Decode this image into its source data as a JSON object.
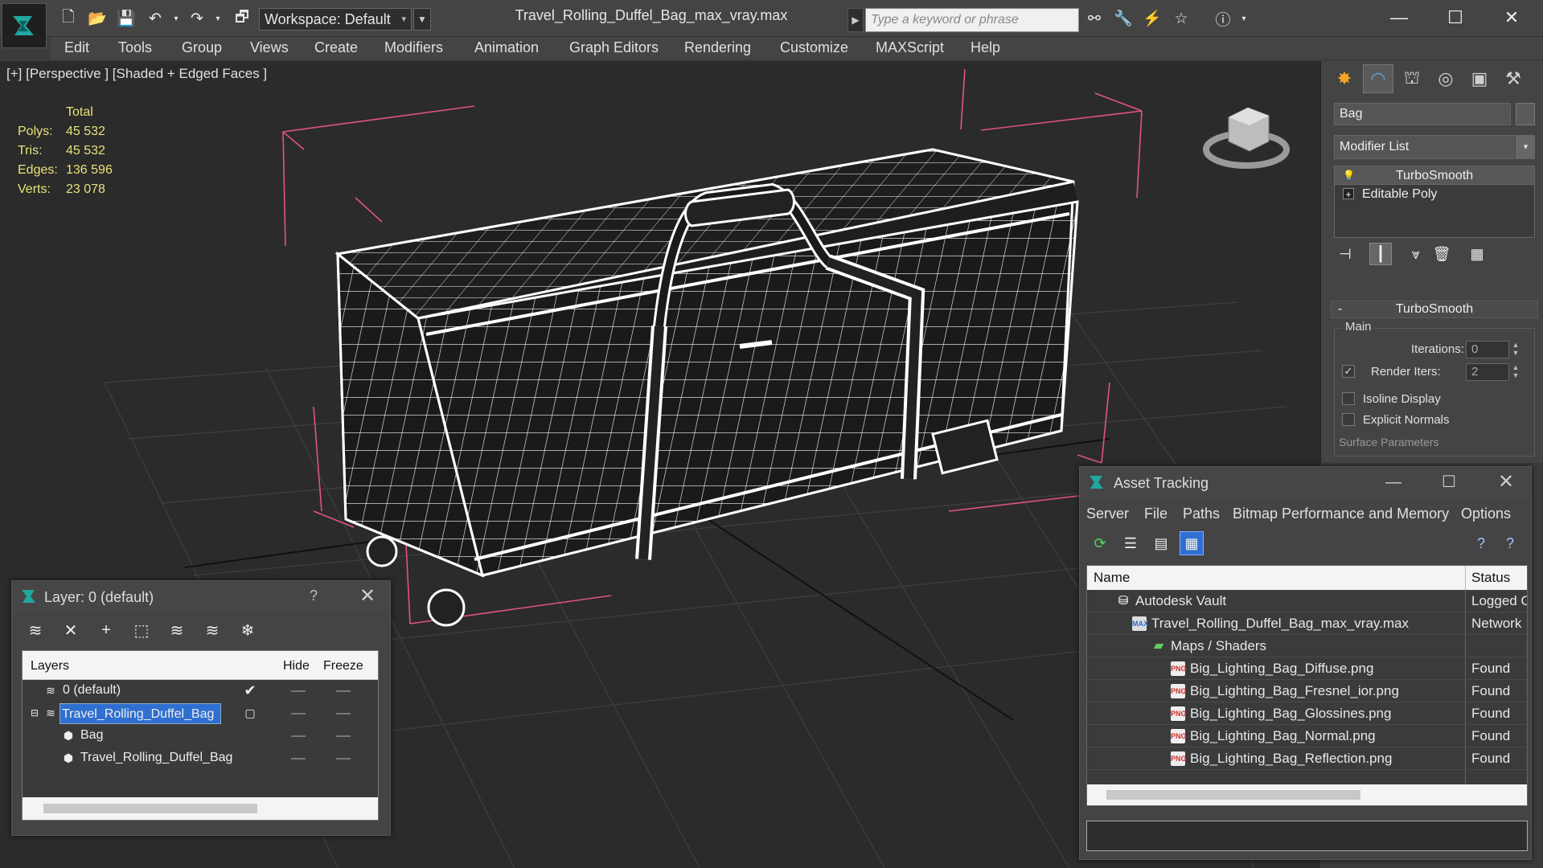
{
  "window": {
    "file_title": "Travel_Rolling_Duffel_Bag_max_vray.max",
    "workspace_label": "Workspace: Default",
    "search_placeholder": "Type a keyword or phrase"
  },
  "menu": {
    "items": [
      "Edit",
      "Tools",
      "Group",
      "Views",
      "Create",
      "Modifiers",
      "Animation",
      "Graph Editors",
      "Rendering",
      "Customize",
      "MAXScript",
      "Help"
    ]
  },
  "viewport": {
    "label": "[+] [Perspective ] [Shaded + Edged Faces ]",
    "stats": {
      "header": "Total",
      "polys_label": "Polys:",
      "polys": "45 532",
      "tris_label": "Tris:",
      "tris": "45 532",
      "edges_label": "Edges:",
      "edges": "136 596",
      "verts_label": "Verts:",
      "verts": "23 078"
    }
  },
  "command_panel": {
    "object_name": "Bag",
    "modifier_list_label": "Modifier List",
    "stack": [
      "TurboSmooth",
      "Editable Poly"
    ],
    "rollout_title": "TurboSmooth",
    "group_label": "Main",
    "iterations_label": "Iterations:",
    "iterations_value": "0",
    "render_iters_label": "Render Iters:",
    "render_iters_value": "2",
    "render_iters_checked": true,
    "isoline_label": "Isoline Display",
    "explicit_normals_label": "Explicit Normals",
    "surface_params_label": "Surface Parameters"
  },
  "layer_dialog": {
    "title": "Layer: 0 (default)",
    "help": "?",
    "columns": [
      "Layers",
      "Hide",
      "Freeze"
    ],
    "rows": [
      {
        "name": "0 (default)",
        "level": 0,
        "current": true
      },
      {
        "name": "Travel_Rolling_Duffel_Bag",
        "level": 0,
        "selected": true
      },
      {
        "name": "Bag",
        "level": 1
      },
      {
        "name": "Travel_Rolling_Duffel_Bag",
        "level": 1
      }
    ]
  },
  "asset_tracking": {
    "title": "Asset Tracking",
    "menu": [
      "Server",
      "File",
      "Paths",
      "Bitmap Performance and Memory",
      "Options"
    ],
    "columns": [
      "Name",
      "Status"
    ],
    "rows": [
      {
        "name": "Autodesk Vault",
        "status": "Logged O",
        "level": 1,
        "icon": "vault"
      },
      {
        "name": "Travel_Rolling_Duffel_Bag_max_vray.max",
        "status": "Network",
        "level": 2,
        "icon": "max"
      },
      {
        "name": "Maps / Shaders",
        "status": "",
        "level": 3,
        "icon": "maps"
      },
      {
        "name": "Big_Lighting_Bag_Diffuse.png",
        "status": "Found",
        "level": 4,
        "icon": "png"
      },
      {
        "name": "Big_Lighting_Bag_Fresnel_ior.png",
        "status": "Found",
        "level": 4,
        "icon": "png"
      },
      {
        "name": "Big_Lighting_Bag_Glossines.png",
        "status": "Found",
        "level": 4,
        "icon": "png"
      },
      {
        "name": "Big_Lighting_Bag_Normal.png",
        "status": "Found",
        "level": 4,
        "icon": "png"
      },
      {
        "name": "Big_Lighting_Bag_Reflection.png",
        "status": "Found",
        "level": 4,
        "icon": "png"
      }
    ]
  },
  "colors": {
    "accent": "#2f6fd1",
    "stats_text": "#e8e27a",
    "bbox": "#e0557a",
    "wire": "#ffffff"
  }
}
